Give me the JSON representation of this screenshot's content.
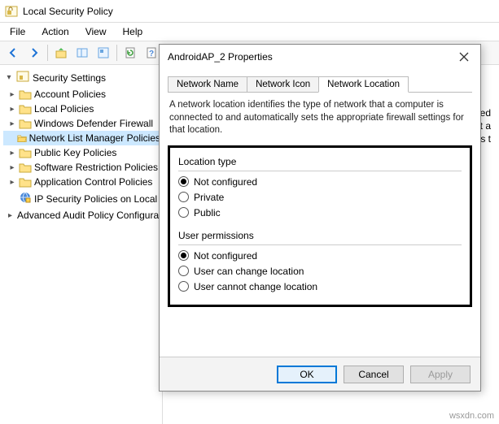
{
  "window": {
    "title": "Local Security Policy"
  },
  "menu": {
    "file": "File",
    "action": "Action",
    "view": "View",
    "help": "Help"
  },
  "tree": {
    "root": "Security Settings",
    "items": [
      {
        "label": "Account Policies"
      },
      {
        "label": "Local Policies"
      },
      {
        "label": "Windows Defender Firewall"
      },
      {
        "label": "Network List Manager Policies",
        "selected": true
      },
      {
        "label": "Public Key Policies"
      },
      {
        "label": "Software Restriction Policies"
      },
      {
        "label": "Application Control Policies"
      },
      {
        "label": "IP Security Policies on Local",
        "ipsec": true
      },
      {
        "label": "Advanced Audit Policy Configuration"
      }
    ]
  },
  "rightpane": {
    "partial1": "tified",
    "partial2": "hat a",
    "partial3": "ects t"
  },
  "dialog": {
    "title": "AndroidAP_2 Properties",
    "tabs": {
      "name": "Network Name",
      "icon": "Network Icon",
      "location": "Network Location"
    },
    "description": "A network location identifies the type of network that a computer is connected to and automatically sets the appropriate firewall settings for that location.",
    "group1": {
      "title": "Location type",
      "opt1": "Not configured",
      "opt2": "Private",
      "opt3": "Public"
    },
    "group2": {
      "title": "User permissions",
      "opt1": "Not configured",
      "opt2": "User can change location",
      "opt3": "User cannot change location"
    },
    "buttons": {
      "ok": "OK",
      "cancel": "Cancel",
      "apply": "Apply"
    }
  },
  "watermark": "wsxdn.com"
}
